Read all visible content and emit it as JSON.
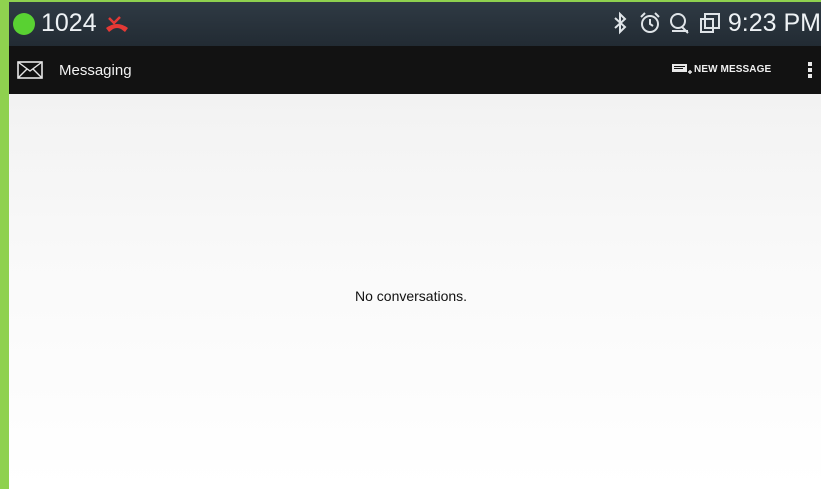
{
  "status_bar": {
    "notification_count": "1024",
    "time": "9:23 PM",
    "icons": [
      "green-dot-icon",
      "missed-call-icon",
      "bluetooth-icon",
      "alarm-icon",
      "sync-icon",
      "screen-icon"
    ]
  },
  "action_bar": {
    "title": "Messaging",
    "new_message_label": "NEW MESSAGE"
  },
  "content": {
    "empty_message": "No conversations."
  },
  "colors": {
    "status_bar": "#222b33",
    "action_bar": "#121212",
    "accent_green": "#59d132",
    "missed_call_red": "#e53935"
  }
}
